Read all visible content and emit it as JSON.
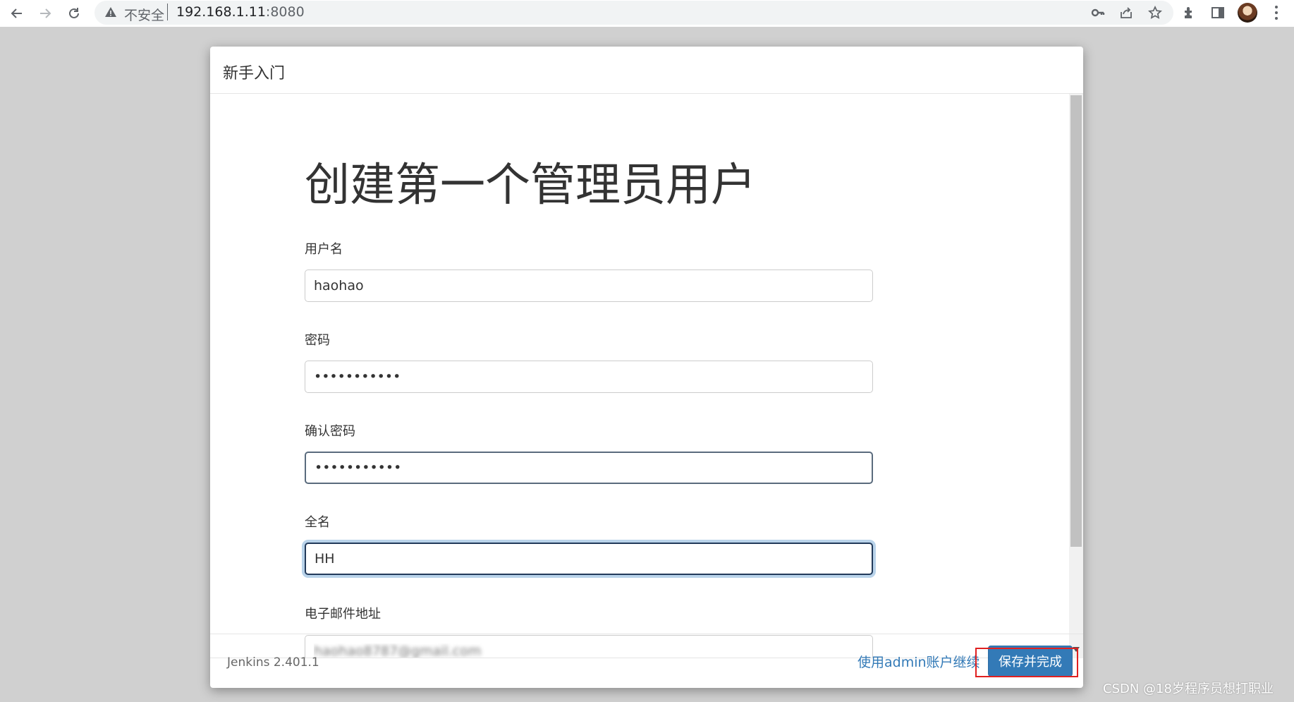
{
  "browser": {
    "url_host": "192.168.1.11",
    "url_port": ":8080",
    "security_label": "不安全"
  },
  "dialog": {
    "title": "新手入门",
    "heading": "创建第一个管理员用户"
  },
  "form": {
    "username": {
      "label": "用户名",
      "value": "haohao"
    },
    "password": {
      "label": "密码",
      "value": "•••••••••••"
    },
    "confirm_password": {
      "label": "确认密码",
      "value": "•••••••••••"
    },
    "full_name": {
      "label": "全名",
      "value": "HH"
    },
    "email": {
      "label": "电子邮件地址",
      "value": "haohao8787@gmail.com"
    }
  },
  "footer": {
    "version": "Jenkins 2.401.1",
    "admin_link": "使用admin账户继续",
    "save_button": "保存并完成"
  },
  "watermark": "CSDN @18岁程序员想打职业",
  "colors": {
    "primary": "#337ab7",
    "highlight": "#e02020",
    "focus_ring": "#b9d3ea"
  }
}
